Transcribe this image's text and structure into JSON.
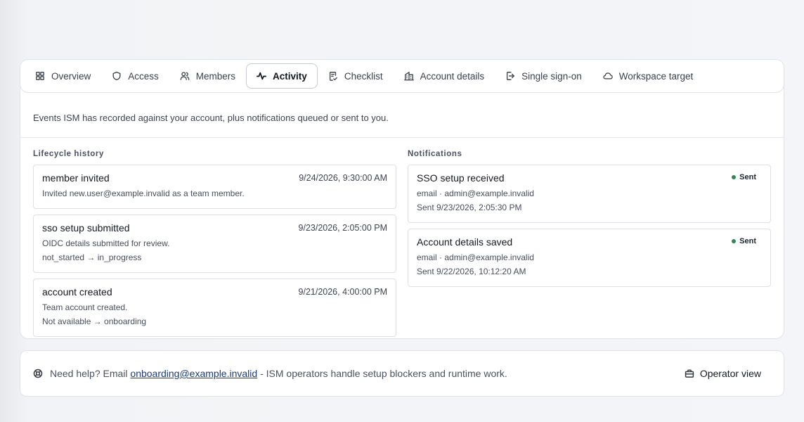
{
  "tabs": [
    {
      "label": "Overview",
      "icon": "grid-icon"
    },
    {
      "label": "Access",
      "icon": "shield-icon"
    },
    {
      "label": "Members",
      "icon": "users-icon"
    },
    {
      "label": "Activity",
      "icon": "activity-icon",
      "active": true
    },
    {
      "label": "Checklist",
      "icon": "clipboard-check-icon"
    },
    {
      "label": "Account details",
      "icon": "building-icon"
    },
    {
      "label": "Single sign-on",
      "icon": "login-icon"
    },
    {
      "label": "Workspace target",
      "icon": "cloud-icon"
    }
  ],
  "activity": {
    "description": "Events ISM has recorded against your account, plus notifications queued or sent to you.",
    "lifecycle_title": "Lifecycle history",
    "lifecycle": [
      {
        "title": "member invited",
        "time": "9/24/2026, 9:30:00 AM",
        "detail": "Invited new.user@example.invalid as a team member.",
        "transition": ""
      },
      {
        "title": "sso setup submitted",
        "time": "9/23/2026, 2:05:00 PM",
        "detail": "OIDC details submitted for review.",
        "transition": "not_started → in_progress"
      },
      {
        "title": "account created",
        "time": "9/21/2026, 4:00:00 PM",
        "detail": "Team account created.",
        "transition": "Not available → onboarding"
      }
    ],
    "notifications_title": "Notifications",
    "notifications": [
      {
        "title": "SSO setup received",
        "status": "Sent",
        "channel": "email · admin@example.invalid",
        "sent": "Sent 9/23/2026, 2:05:30 PM"
      },
      {
        "title": "Account details saved",
        "status": "Sent",
        "channel": "email · admin@example.invalid",
        "sent": "Sent 9/22/2026, 10:12:20 AM"
      }
    ]
  },
  "footer": {
    "help_prefix": "Need help? Email ",
    "help_email": "onboarding@example.invalid",
    "help_suffix": " - ISM operators handle setup blockers and runtime work.",
    "operator_label": "Operator view"
  },
  "colors": {
    "status_sent": "#2f8a52",
    "link": "#1a3c7a"
  }
}
